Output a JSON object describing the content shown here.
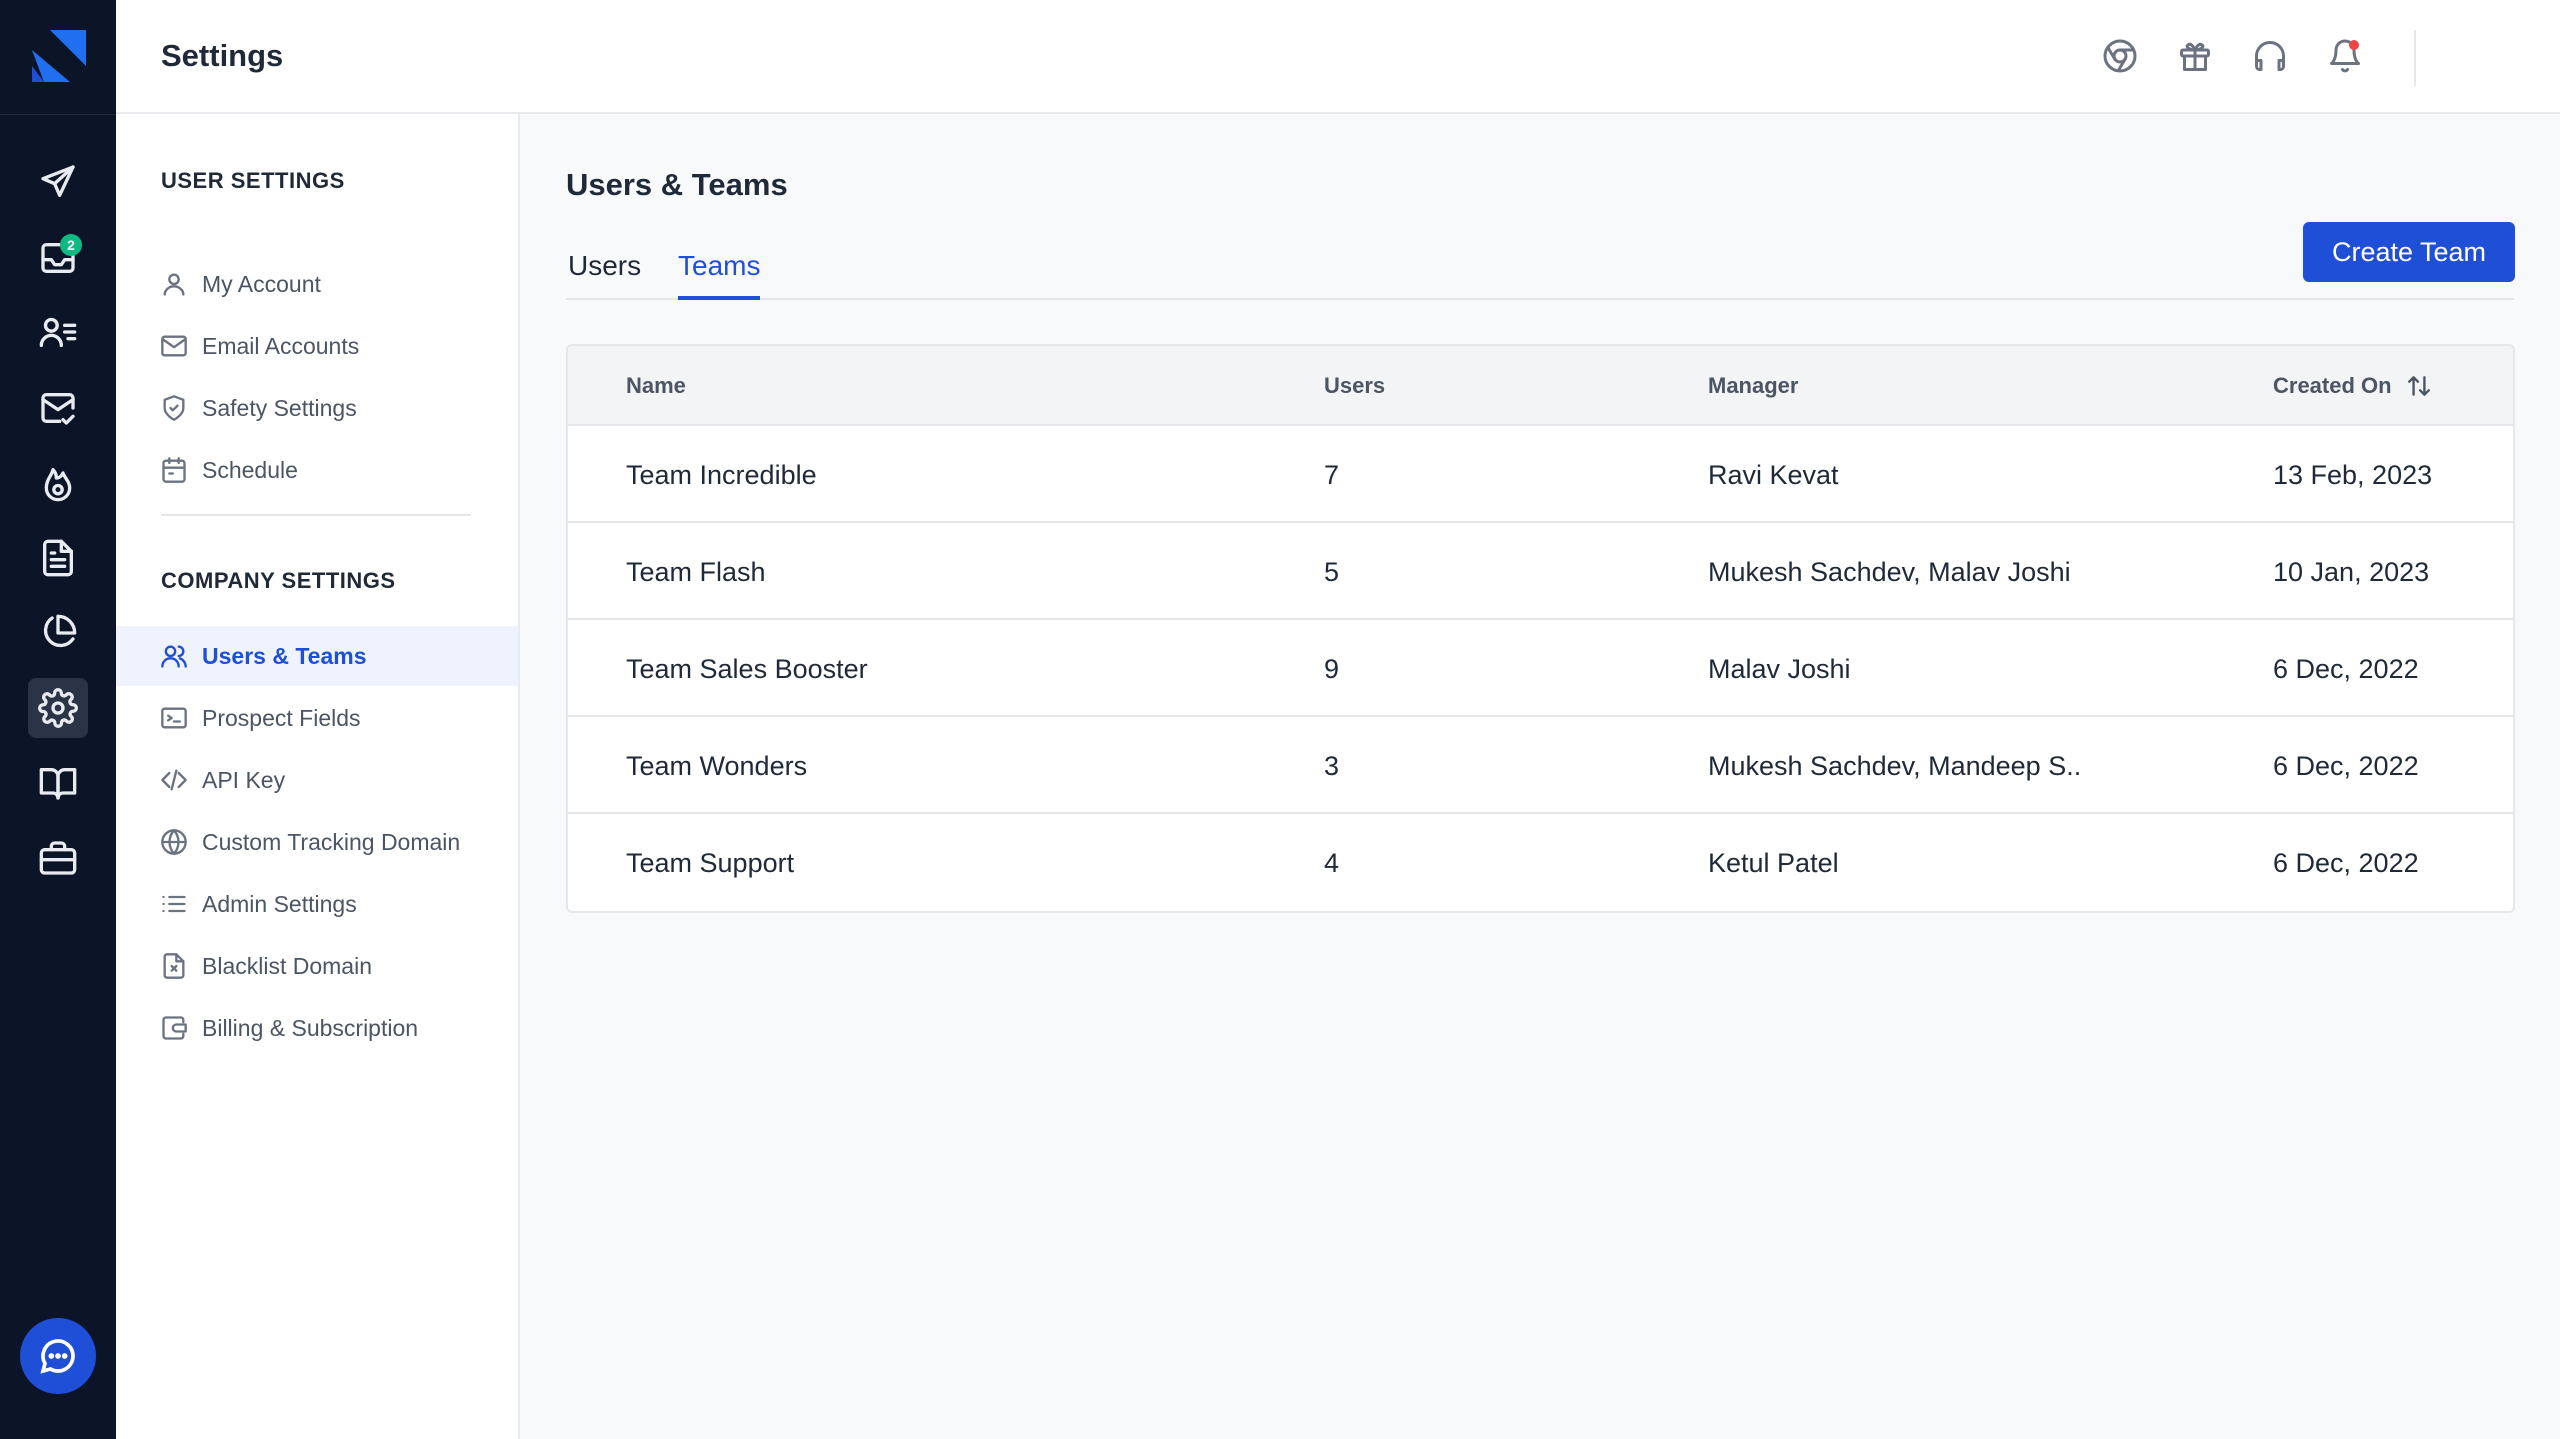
{
  "app": {
    "title": "Settings"
  },
  "rail": {
    "items": [
      {
        "icon": "send-icon"
      },
      {
        "icon": "inbox-icon",
        "badge": "2"
      },
      {
        "icon": "contacts-icon"
      },
      {
        "icon": "mail-check-icon"
      },
      {
        "icon": "flame-icon"
      },
      {
        "icon": "document-icon"
      },
      {
        "icon": "pie-chart-icon"
      },
      {
        "icon": "gear-icon",
        "active": true
      },
      {
        "icon": "book-icon"
      },
      {
        "icon": "briefcase-icon"
      }
    ]
  },
  "header": {
    "icons": [
      "chrome-icon",
      "gift-icon",
      "headset-icon",
      "bell-icon"
    ]
  },
  "sidebar": {
    "user_heading": "USER SETTINGS",
    "user_items": [
      {
        "label": "My Account",
        "icon": "user-icon"
      },
      {
        "label": "Email Accounts",
        "icon": "envelope-icon"
      },
      {
        "label": "Safety Settings",
        "icon": "shield-icon"
      },
      {
        "label": "Schedule",
        "icon": "calendar-icon"
      }
    ],
    "company_heading": "COMPANY SETTINGS",
    "company_items": [
      {
        "label": "Users & Teams",
        "icon": "users-icon",
        "active": true
      },
      {
        "label": "Prospect Fields",
        "icon": "terminal-icon"
      },
      {
        "label": "API Key",
        "icon": "code-icon"
      },
      {
        "label": "Custom Tracking Domain",
        "icon": "globe-icon"
      },
      {
        "label": "Admin Settings",
        "icon": "list-icon"
      },
      {
        "label": "Blacklist Domain",
        "icon": "file-x-icon"
      },
      {
        "label": "Billing & Subscription",
        "icon": "wallet-icon"
      }
    ]
  },
  "main": {
    "title": "Users & Teams",
    "tabs": [
      {
        "label": "Users"
      },
      {
        "label": "Teams",
        "active": true
      }
    ],
    "create_button": "Create Team",
    "table": {
      "headers": [
        "Name",
        "Users",
        "Manager",
        "Created On"
      ],
      "rows": [
        [
          "Team Incredible",
          "7",
          "Ravi Kevat",
          "13 Feb, 2023"
        ],
        [
          "Team Flash",
          "5",
          "Mukesh Sachdev, Malav Joshi",
          "10 Jan, 2023"
        ],
        [
          "Team Sales Booster",
          "9",
          "Malav Joshi",
          "6 Dec, 2022"
        ],
        [
          "Team Wonders",
          "3",
          "Mukesh Sachdev, Mandeep S..",
          "6 Dec, 2022"
        ],
        [
          "Team Support",
          "4",
          "Ketul Patel",
          "6 Dec, 2022"
        ]
      ]
    }
  },
  "colors": {
    "accent": "#1f4fd6",
    "rail_bg": "#0c1527",
    "badge": "#10b981"
  }
}
